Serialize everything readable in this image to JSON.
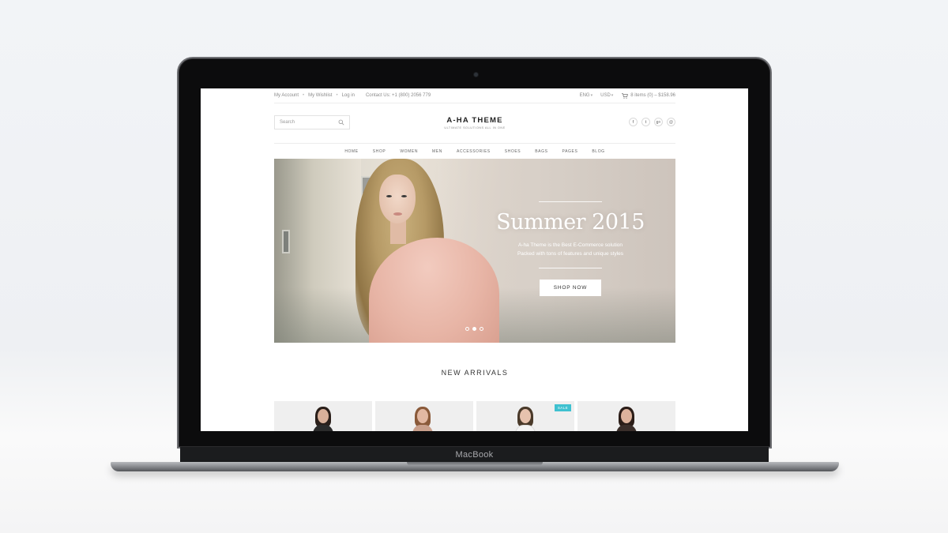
{
  "device": {
    "brand_label": "MacBook"
  },
  "topbar": {
    "links": [
      "My Account",
      "My Wishlist",
      "Log in"
    ],
    "contact": "Contact Us: +1 (800) 2056 779",
    "language": "ENG",
    "currency": "USD",
    "cart_summary": "8 items (0) – $158.96"
  },
  "header": {
    "search_placeholder": "Search",
    "logo_title": "A-HA THEME",
    "logo_tagline": "ULTIMATE SOLUTIONS ALL IN ONE",
    "socials": [
      "f",
      "t",
      "g+",
      "@"
    ]
  },
  "nav": {
    "items": [
      "HOME",
      "SHOP",
      "WOMEN",
      "MEN",
      "ACCESSORIES",
      "SHOES",
      "BAGS",
      "PAGES",
      "BLOG"
    ]
  },
  "hero": {
    "title": "Summer 2015",
    "subtitle_line1": "A-ha Theme is the Best E-Commerce solution",
    "subtitle_line2": "Packed with tons of features and unique styles",
    "cta_label": "SHOP NOW",
    "slide_count": 3,
    "active_slide": 1
  },
  "new_arrivals": {
    "title": "NEW ARRIVALS",
    "products": [
      {
        "badge": ""
      },
      {
        "badge": ""
      },
      {
        "badge": "SALE"
      },
      {
        "badge": ""
      }
    ]
  },
  "colors": {
    "sale_badge": "#3fc1d0",
    "screen_bg": "#ffffff",
    "product_bg": "#efefef"
  }
}
